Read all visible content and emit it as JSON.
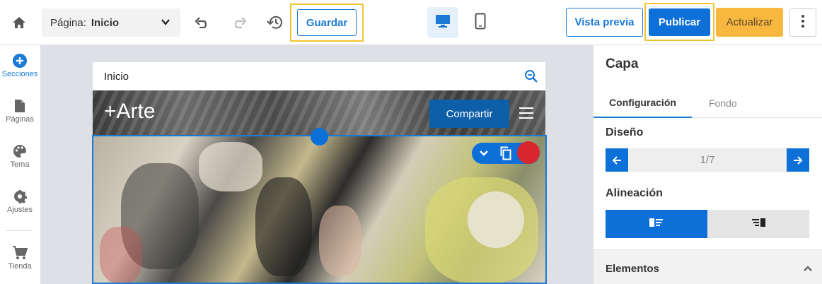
{
  "toolbar": {
    "page_label": "Página:",
    "page_value": "Inicio",
    "save_label": "Guardar",
    "preview_label": "Vista previa",
    "publish_label": "Publicar",
    "update_label": "Actualizar",
    "accent": "#0d6fd8",
    "highlight": "#f4c430",
    "update_color": "#f8b840"
  },
  "sidebar": {
    "items": [
      {
        "label": "Secciones",
        "icon": "add-circle-icon"
      },
      {
        "label": "Páginas",
        "icon": "page-icon"
      },
      {
        "label": "Tema",
        "icon": "palette-icon"
      },
      {
        "label": "Ajustes",
        "icon": "gear-icon"
      },
      {
        "label": "Tienda",
        "icon": "cart-icon"
      }
    ]
  },
  "canvas": {
    "url_title": "Inicio",
    "logo": "+Arte",
    "share_label": "Compartir"
  },
  "panel": {
    "title": "Capa",
    "tabs": [
      "Configuración",
      "Fondo"
    ],
    "design_label": "Diseño",
    "design_page": "1/7",
    "alignment_label": "Alineación",
    "elements_label": "Elementos"
  }
}
